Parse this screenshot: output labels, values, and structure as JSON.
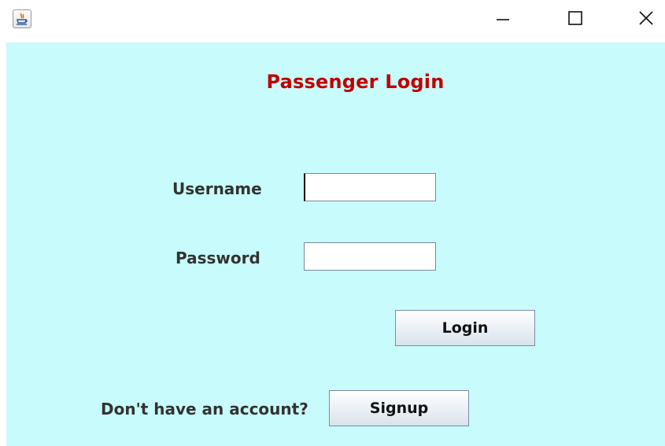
{
  "window": {
    "icon": "java-cup-icon",
    "controls": {
      "minimize": "minimize-icon",
      "maximize": "maximize-icon",
      "close": "close-icon"
    }
  },
  "form": {
    "title": "Passenger Login",
    "username_label": "Username",
    "username_value": "",
    "password_label": "Password",
    "password_value": "",
    "login_button": "Login",
    "account_prompt": "Don't have an account?",
    "signup_button": "Signup"
  },
  "colors": {
    "background": "#c8fbfb",
    "title": "#c00000"
  }
}
